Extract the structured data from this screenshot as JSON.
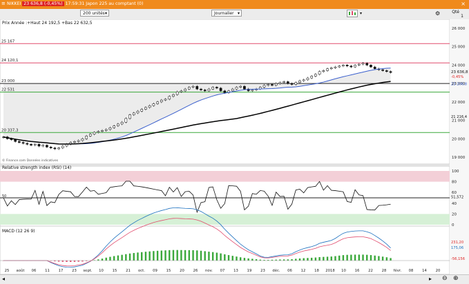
{
  "titlebar": {
    "menu": "≡",
    "instrument": "NIKKEI",
    "price": "23 636,8",
    "change": "(-0,45%)",
    "time": "17:59:31",
    "market": "Japon 225 au comptant (0)",
    "close": "×"
  },
  "toolbar": {
    "quantity_select": "200 unités",
    "period_select": "Journalier",
    "qte_label": "Qté",
    "qte_value": "1"
  },
  "price_panel": {
    "label": "Prix",
    "info": "Année :+Haut 24 192,5 +Bas 22 632,5",
    "source": "© Finance.com Données indicatives",
    "levels": [
      {
        "label": "25 167",
        "value": 25167,
        "color": "#e14b6d"
      },
      {
        "label": "24 120,1",
        "value": 24120.1,
        "color": "#e14b6d"
      },
      {
        "label": "23 000",
        "value": 23000,
        "color": "#222222"
      },
      {
        "label": "22 531",
        "value": 22531,
        "color": "#3aa83a"
      },
      {
        "label": "20 337,3",
        "value": 20337.3,
        "color": "#3aa83a"
      }
    ],
    "axis_ticks": [
      "26 000",
      "25 000",
      "24 000",
      "23 000",
      "22 000",
      "21 000",
      "20 000",
      "19 000"
    ],
    "axis_tick_values": [
      26000,
      25000,
      24000,
      23000,
      22000,
      21000,
      20000,
      19000
    ],
    "right_labels": {
      "last_price": "23 636,8",
      "change_pct": "-0,45%",
      "ma_short": "23 206,8",
      "ma_long": "21 216,4"
    }
  },
  "rsi_panel": {
    "label": "Relative strength index (RSI) (14)",
    "level_label": "50",
    "axis_ticks": [
      "100",
      "80",
      "60",
      "40",
      "20",
      "0"
    ],
    "axis_tick_values": [
      100,
      80,
      60,
      40,
      20,
      0
    ],
    "value_label": "51,572"
  },
  "macd_panel": {
    "label": "MACD (12 26 9)",
    "value_macd": "231,20",
    "value_signal": "175,06",
    "value_hist": "-56,156"
  },
  "x_axis": {
    "labels": [
      "25",
      "août",
      "06",
      "11",
      "17",
      "23",
      "sept.",
      "10",
      "15",
      "21",
      "oct.",
      "09",
      "15",
      "20",
      "26",
      "nov.",
      "07",
      "13",
      "19",
      "23",
      "déc.",
      "06",
      "12",
      "18",
      "2018",
      "10",
      "16",
      "22",
      "28",
      "févr.",
      "08",
      "14",
      "20"
    ]
  },
  "colors": {
    "accent": "#f08a1c",
    "up_candle": "#ffffff",
    "down_candle": "#111111",
    "ma_short": "#3a5fcd",
    "ma_long": "#000000",
    "rsi_overbought": "#f3cfd7",
    "rsi_oversold": "#d6f0d6",
    "macd_pos": "#3aa83a",
    "macd_neg": "#e14b6d"
  },
  "icons": {
    "menu": "hamburger-icon",
    "close": "close-icon",
    "chart_type": "candlestick-icon",
    "settings": "gear-icon"
  }
}
